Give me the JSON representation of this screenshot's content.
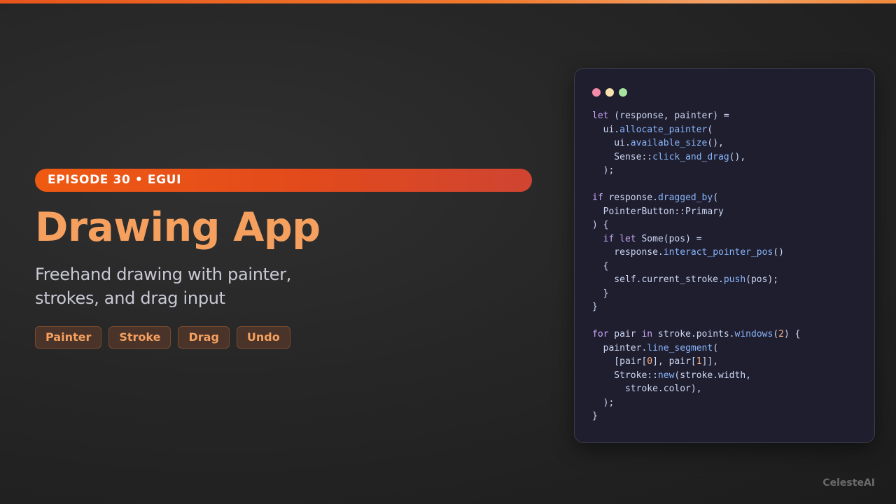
{
  "episode_badge": "EPISODE 30 • EGUI",
  "title": "Drawing App",
  "subtitle": "Freehand drawing with painter, strokes, and drag input",
  "tags": [
    "Painter",
    "Stroke",
    "Drag",
    "Undo"
  ],
  "window_dot_colors": [
    "#f38ba8",
    "#f9e2af",
    "#a6e3a1"
  ],
  "accent_color": "#f5a05f",
  "code": [
    [
      [
        "kw",
        "let"
      ],
      [
        "t",
        " (response, painter) ="
      ]
    ],
    [
      [
        "t",
        "  ui."
      ],
      [
        "fn",
        "allocate_painter"
      ],
      [
        "t",
        "("
      ]
    ],
    [
      [
        "t",
        "    ui."
      ],
      [
        "fn",
        "available_size"
      ],
      [
        "t",
        "(),"
      ]
    ],
    [
      [
        "t",
        "    Sense::"
      ],
      [
        "fn",
        "click_and_drag"
      ],
      [
        "t",
        "(),"
      ]
    ],
    [
      [
        "t",
        "  );"
      ]
    ],
    [],
    [
      [
        "kw",
        "if"
      ],
      [
        "t",
        " response."
      ],
      [
        "fn",
        "dragged_by"
      ],
      [
        "t",
        "("
      ]
    ],
    [
      [
        "t",
        "  PointerButton::Primary"
      ]
    ],
    [
      [
        "t",
        ") {"
      ]
    ],
    [
      [
        "t",
        "  "
      ],
      [
        "kw",
        "if let"
      ],
      [
        "t",
        " Some(pos) ="
      ]
    ],
    [
      [
        "t",
        "    response."
      ],
      [
        "fn",
        "interact_pointer_pos"
      ],
      [
        "t",
        "()"
      ]
    ],
    [
      [
        "t",
        "  {"
      ]
    ],
    [
      [
        "t",
        "    self.current_stroke."
      ],
      [
        "fn",
        "push"
      ],
      [
        "t",
        "(pos);"
      ]
    ],
    [
      [
        "t",
        "  }"
      ]
    ],
    [
      [
        "t",
        "}"
      ]
    ],
    [],
    [
      [
        "kw",
        "for"
      ],
      [
        "t",
        " pair "
      ],
      [
        "kw",
        "in"
      ],
      [
        "t",
        " stroke.points."
      ],
      [
        "fn",
        "windows"
      ],
      [
        "t",
        "("
      ],
      [
        "num",
        "2"
      ],
      [
        "t",
        ") {"
      ]
    ],
    [
      [
        "t",
        "  painter."
      ],
      [
        "fn",
        "line_segment"
      ],
      [
        "t",
        "("
      ]
    ],
    [
      [
        "t",
        "    [pair["
      ],
      [
        "num",
        "0"
      ],
      [
        "t",
        "], pair["
      ],
      [
        "num",
        "1"
      ],
      [
        "t",
        "]],"
      ]
    ],
    [
      [
        "t",
        "    Stroke::"
      ],
      [
        "fn",
        "new"
      ],
      [
        "t",
        "(stroke.width,"
      ]
    ],
    [
      [
        "t",
        "      stroke.color),"
      ]
    ],
    [
      [
        "t",
        "  );"
      ]
    ],
    [
      [
        "t",
        "}"
      ]
    ]
  ],
  "code_colors": {
    "kw": "#cba6f7",
    "fn": "#89b4fa",
    "num": "#fab387",
    "t": "#cdd6f4"
  },
  "watermark": "CelesteAI"
}
